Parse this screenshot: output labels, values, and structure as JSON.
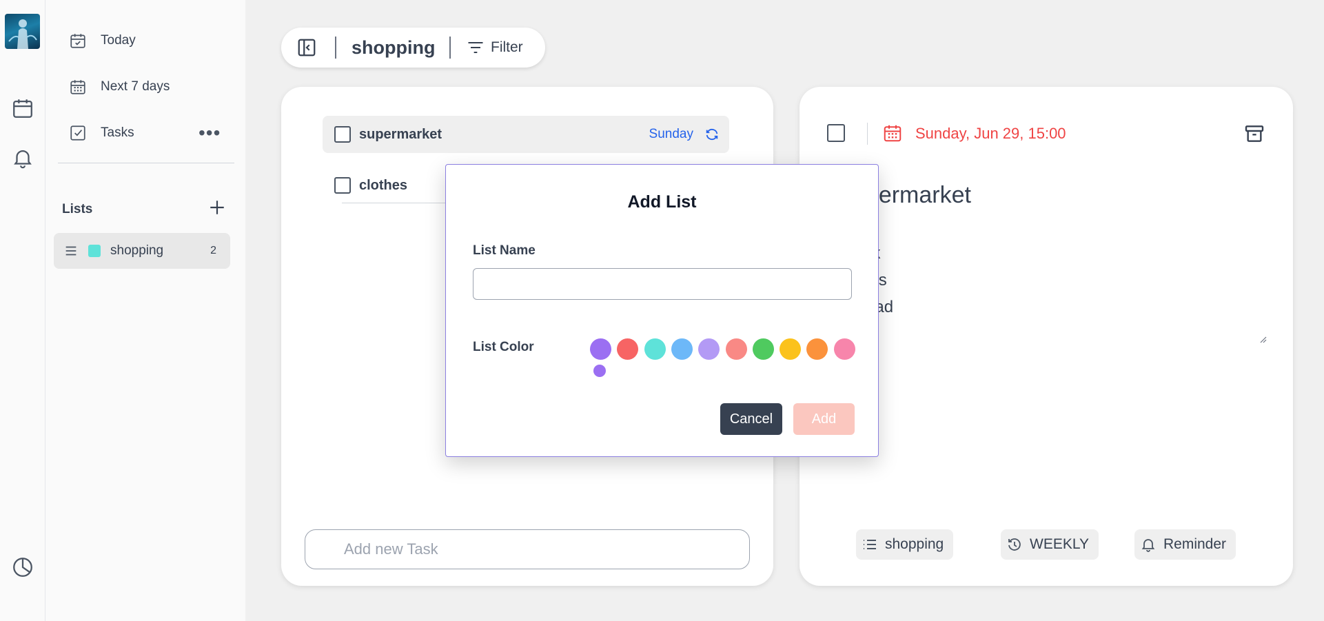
{
  "sidebar": {
    "nav": [
      {
        "label": "Today",
        "icon": "calendar-check-icon"
      },
      {
        "label": "Next 7 days",
        "icon": "calendar-grid-icon"
      },
      {
        "label": "Tasks",
        "icon": "checkbox-icon"
      }
    ],
    "more_label": "•••",
    "lists_title": "Lists",
    "lists": [
      {
        "name": "shopping",
        "count": "2",
        "color": "#5ee2d9"
      }
    ]
  },
  "header": {
    "list_title": "shopping",
    "filter_label": "Filter"
  },
  "tasks": [
    {
      "title": "supermarket",
      "day": "Sunday",
      "repeat": true
    },
    {
      "title": "clothes"
    }
  ],
  "add_task": {
    "placeholder": "Add new Task"
  },
  "detail": {
    "date": "Sunday, Jun 29, 15:00",
    "title": "supermarket",
    "notes": "- milk\n- eggs\n- bread",
    "chips": {
      "list": "shopping",
      "repeat": "WEEKLY",
      "reminder": "Reminder"
    }
  },
  "modal": {
    "title": "Add List",
    "name_label": "List Name",
    "name_value": "",
    "color_label": "List Color",
    "colors": [
      "#9b6ff2",
      "#f76464",
      "#5ee2d9",
      "#6db8f8",
      "#b39af5",
      "#f98985",
      "#4fca5f",
      "#fbc21c",
      "#fb923c",
      "#f785ab"
    ],
    "selected_color": "#9b6ff2",
    "cancel_label": "Cancel",
    "add_label": "Add"
  },
  "colors": {
    "accent_blue": "#2563eb",
    "date_red": "#ef4444",
    "dark_button": "#374151",
    "disabled_add": "#fbc7bf"
  }
}
